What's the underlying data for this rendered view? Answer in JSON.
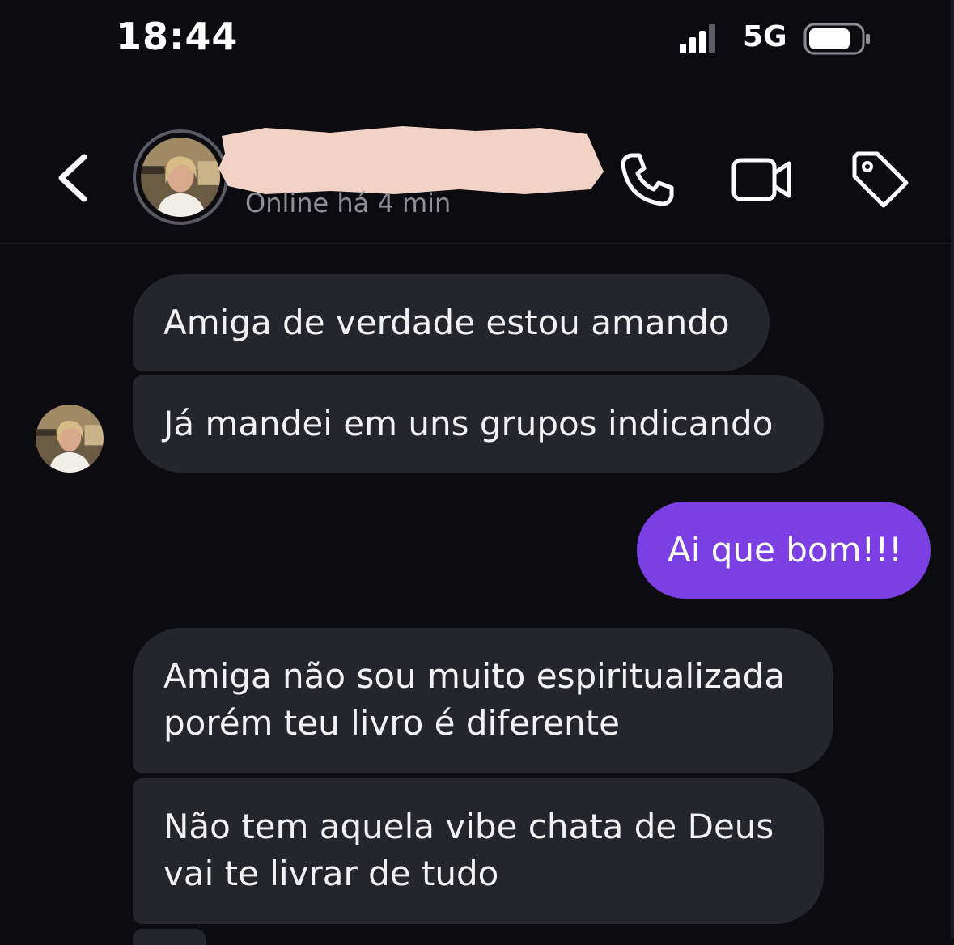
{
  "status_bar": {
    "time": "18:44",
    "network": "5G",
    "signal_icon": "cellular-signal-icon",
    "battery_icon": "battery-icon"
  },
  "header": {
    "back_icon": "chevron-left-icon",
    "contact_name": "",
    "online_status": "Online há 4 min",
    "call_icon": "phone-icon",
    "video_icon": "video-camera-icon",
    "tag_icon": "tag-icon"
  },
  "messages": [
    {
      "direction": "incoming",
      "text": "Amiga de verdade estou amando"
    },
    {
      "direction": "incoming",
      "text": "Já mandei em uns grupos indicando"
    },
    {
      "direction": "outgoing",
      "text": "Ai que bom!!!"
    },
    {
      "direction": "incoming",
      "lines": [
        "Amiga não sou muito espiritualizada",
        "porém teu livro é diferente"
      ]
    },
    {
      "direction": "incoming",
      "lines": [
        "Não tem aquela vibe chata de Deus",
        "vai te livrar de tudo"
      ]
    }
  ],
  "colors": {
    "background": "#0c0c10",
    "incoming_bubble": "#25262c",
    "outgoing_bubble": "#7b3fe4",
    "redaction": "#f2d2c4"
  }
}
